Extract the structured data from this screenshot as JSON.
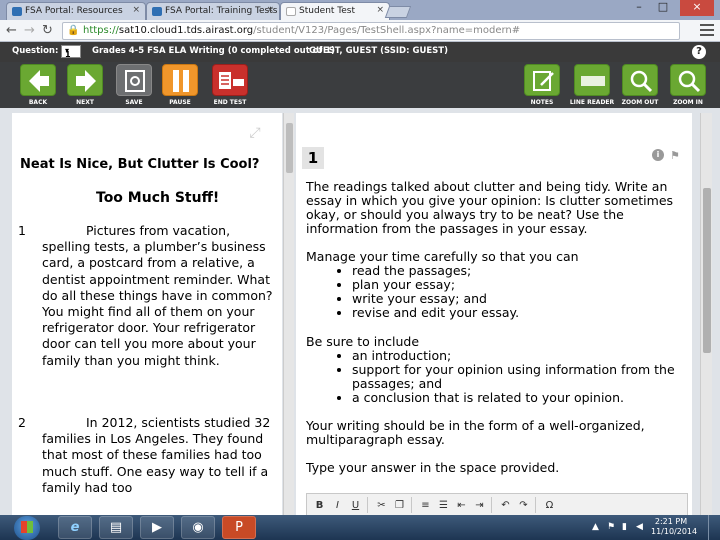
{
  "browser": {
    "tabs": [
      {
        "label": "FSA Portal: Resources"
      },
      {
        "label": "FSA Portal: Training Tests"
      },
      {
        "label": "Student Test"
      }
    ],
    "url_secure": "https://",
    "url_host": "sat10.cloud1.tds.airast.org",
    "url_path": "/student/V123/Pages/TestShell.aspx?name=modern#"
  },
  "infobar": {
    "question_label": "Question:",
    "question_value": "1",
    "test_name": "Grades 4-5 FSA ELA Writing (0 completed out of 1)",
    "student": "GUEST, GUEST (SSID: GUEST)",
    "help": "?"
  },
  "toolbar": {
    "back": "BACK",
    "next": "NEXT",
    "save": "SAVE",
    "pause": "PAUSE",
    "end_test": "END TEST",
    "notes": "NOTES",
    "line_reader": "LINE READER",
    "zoom_out": "ZOOM OUT",
    "zoom_in": "ZOOM IN"
  },
  "passage": {
    "title": "Neat Is Nice, But Clutter Is Cool?",
    "subtitle": "Too Much Stuff!",
    "paragraphs": [
      {
        "num": "1",
        "text": "Pictures from vacation, spelling tests, a plumber’s business card, a postcard from a relative, a dentist appointment reminder. What do all these things have in common? You might find all of them on your refrigerator door. Your refrigerator door can tell you more about your family than you might think."
      },
      {
        "num": "2",
        "text": "In 2012, scientists studied 32 families in Los Angeles. They found that most of these families had too much stuff. One easy way to tell if a family had too"
      }
    ]
  },
  "question": {
    "number": "1",
    "prompt": "The readings talked about clutter and being tidy. Write an essay in which you give your opinion: Is clutter sometimes okay, or should you always try to be neat? Use the information from the passages in your essay.",
    "manage_intro": "Manage your time carefully so that you can",
    "manage_items": [
      "read the passages;",
      "plan your essay;",
      "write your essay; and",
      "revise and edit your essay."
    ],
    "include_intro": "Be sure to include",
    "include_items": [
      "an introduction;",
      "support for your opinion using information from the passages; and",
      "a conclusion that is related to your opinion."
    ],
    "form_text": "Your writing should be in the form of a well-organized, multiparagraph essay.",
    "type_text": "Type your answer in the space provided."
  },
  "taskbar": {
    "time": "2:21 PM",
    "date": "11/10/2014"
  },
  "colors": {
    "toolbar_bg": "#3b3d3f",
    "green_button": "#6aa832",
    "orange_button": "#f0962b",
    "red_button": "#c9302c"
  }
}
